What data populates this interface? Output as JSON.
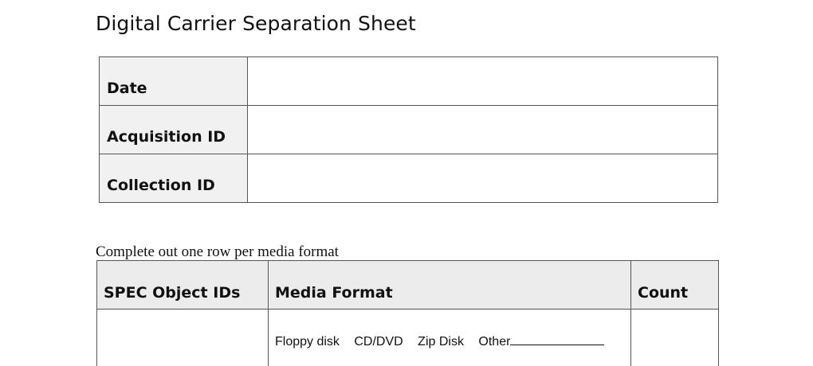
{
  "document": {
    "title": "Digital Carrier Separation Sheet"
  },
  "info_table": {
    "rows": [
      {
        "label": "Date",
        "value": ""
      },
      {
        "label": "Acquisition ID",
        "value": ""
      },
      {
        "label": "Collection ID",
        "value": ""
      }
    ]
  },
  "instructions": "Complete out one row per media format",
  "media_table": {
    "headers": [
      "SPEC Object IDs",
      "Media Format",
      "Count"
    ],
    "format_options": [
      "Floppy disk",
      "CD/DVD",
      "Zip Disk",
      "Other"
    ],
    "rows": [
      {
        "object_ids": "",
        "count": ""
      }
    ]
  },
  "colors": {
    "label_background": "#f1f1f1",
    "header_background": "#ececec",
    "border": "#555555"
  }
}
